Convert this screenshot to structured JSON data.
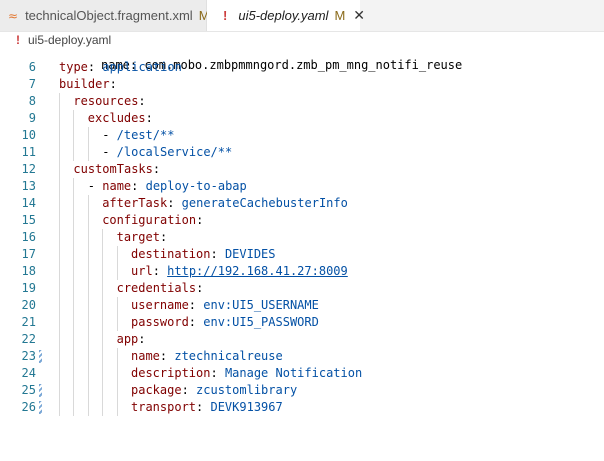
{
  "tabs": [
    {
      "label": "technicalObject.fragment.xml",
      "status": "M",
      "icon": "rss-xml-icon",
      "icon_glyph": "≈"
    },
    {
      "label": "ui5-deploy.yaml",
      "status": "M",
      "icon": "yaml-warning-icon",
      "icon_glyph": "!",
      "close": "✕"
    }
  ],
  "breadcrumb": {
    "icon_glyph": "!",
    "label": "ui5-deploy.yaml"
  },
  "colors": {
    "key": "#800000",
    "value": "#0451a5",
    "line_number": "#237893"
  },
  "code": {
    "partial_line": "name: com.mobo.zmbpmmngord.zmb_pm_mng_notifi_reuse",
    "lines": [
      {
        "n": "6",
        "indent": 0,
        "parts": [
          {
            "t": "type",
            "c": "k"
          },
          {
            "t": ": ",
            "c": "p"
          },
          {
            "t": "application",
            "c": "v"
          }
        ]
      },
      {
        "n": "7",
        "indent": 0,
        "parts": [
          {
            "t": "builder",
            "c": "k"
          },
          {
            "t": ":",
            "c": "p"
          }
        ]
      },
      {
        "n": "8",
        "indent": 1,
        "parts": [
          {
            "t": "resources",
            "c": "k"
          },
          {
            "t": ":",
            "c": "p"
          }
        ]
      },
      {
        "n": "9",
        "indent": 2,
        "parts": [
          {
            "t": "excludes",
            "c": "k"
          },
          {
            "t": ":",
            "c": "p"
          }
        ]
      },
      {
        "n": "10",
        "indent": 3,
        "parts": [
          {
            "t": "- ",
            "c": "p"
          },
          {
            "t": "/test/**",
            "c": "v"
          }
        ]
      },
      {
        "n": "11",
        "indent": 3,
        "parts": [
          {
            "t": "- ",
            "c": "p"
          },
          {
            "t": "/localService/**",
            "c": "v"
          }
        ]
      },
      {
        "n": "12",
        "indent": 1,
        "parts": [
          {
            "t": "customTasks",
            "c": "k"
          },
          {
            "t": ":",
            "c": "p"
          }
        ]
      },
      {
        "n": "13",
        "indent": 2,
        "parts": [
          {
            "t": "- ",
            "c": "p"
          },
          {
            "t": "name",
            "c": "k"
          },
          {
            "t": ": ",
            "c": "p"
          },
          {
            "t": "deploy-to-abap",
            "c": "v"
          }
        ]
      },
      {
        "n": "14",
        "indent": 3,
        "parts": [
          {
            "t": "afterTask",
            "c": "k"
          },
          {
            "t": ": ",
            "c": "p"
          },
          {
            "t": "generateCachebusterInfo",
            "c": "v"
          }
        ]
      },
      {
        "n": "15",
        "indent": 3,
        "parts": [
          {
            "t": "configuration",
            "c": "k"
          },
          {
            "t": ":",
            "c": "p"
          }
        ]
      },
      {
        "n": "16",
        "indent": 4,
        "parts": [
          {
            "t": "target",
            "c": "k"
          },
          {
            "t": ":",
            "c": "p"
          }
        ]
      },
      {
        "n": "17",
        "indent": 5,
        "parts": [
          {
            "t": "destination",
            "c": "k"
          },
          {
            "t": ": ",
            "c": "p"
          },
          {
            "t": "DEVIDES",
            "c": "v"
          }
        ]
      },
      {
        "n": "18",
        "indent": 5,
        "parts": [
          {
            "t": "url",
            "c": "k"
          },
          {
            "t": ": ",
            "c": "p"
          },
          {
            "t": "http://192.168.41.27:8009",
            "c": "u"
          }
        ]
      },
      {
        "n": "19",
        "indent": 4,
        "parts": [
          {
            "t": "credentials",
            "c": "k"
          },
          {
            "t": ":",
            "c": "p"
          }
        ]
      },
      {
        "n": "20",
        "indent": 5,
        "parts": [
          {
            "t": "username",
            "c": "k"
          },
          {
            "t": ": ",
            "c": "p"
          },
          {
            "t": "env:UI5_USERNAME",
            "c": "v"
          }
        ]
      },
      {
        "n": "21",
        "indent": 5,
        "parts": [
          {
            "t": "password",
            "c": "k"
          },
          {
            "t": ": ",
            "c": "p"
          },
          {
            "t": "env:UI5_PASSWORD",
            "c": "v"
          }
        ]
      },
      {
        "n": "22",
        "indent": 4,
        "parts": [
          {
            "t": "app",
            "c": "k"
          },
          {
            "t": ":",
            "c": "p"
          }
        ]
      },
      {
        "n": "23",
        "indent": 5,
        "mark": true,
        "parts": [
          {
            "t": "name",
            "c": "k"
          },
          {
            "t": ": ",
            "c": "p"
          },
          {
            "t": "ztechnicalreuse",
            "c": "v"
          }
        ]
      },
      {
        "n": "24",
        "indent": 5,
        "parts": [
          {
            "t": "description",
            "c": "k"
          },
          {
            "t": ": ",
            "c": "p"
          },
          {
            "t": "Manage Notification",
            "c": "v"
          }
        ]
      },
      {
        "n": "25",
        "indent": 5,
        "mark": true,
        "parts": [
          {
            "t": "package",
            "c": "k"
          },
          {
            "t": ": ",
            "c": "p"
          },
          {
            "t": "zcustomlibrary",
            "c": "v"
          }
        ]
      },
      {
        "n": "26",
        "indent": 5,
        "mark": true,
        "parts": [
          {
            "t": "transport",
            "c": "k"
          },
          {
            "t": ": ",
            "c": "p"
          },
          {
            "t": "DEVK913967",
            "c": "v"
          }
        ]
      }
    ]
  }
}
